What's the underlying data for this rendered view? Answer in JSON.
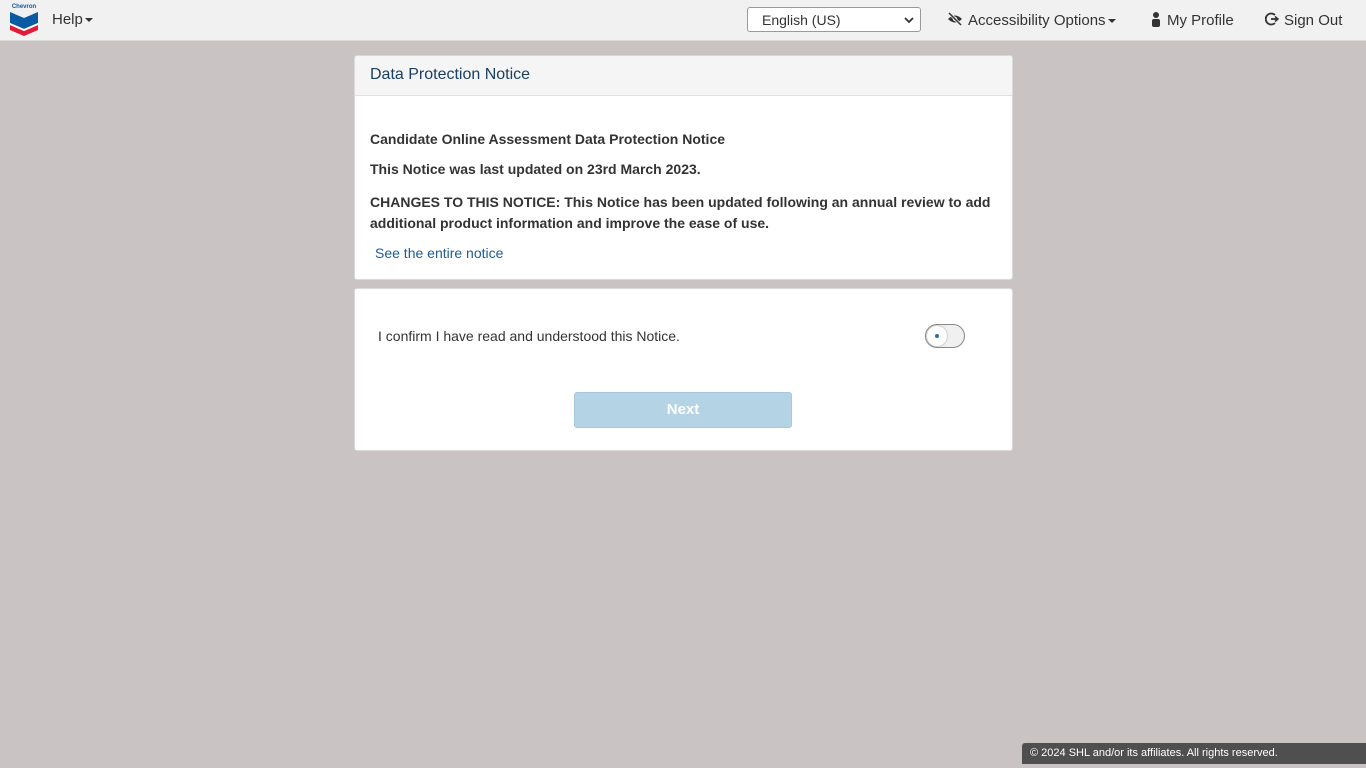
{
  "header": {
    "logo_text": "Chevron",
    "help_label": "Help",
    "language": {
      "selected": "English (US)"
    },
    "accessibility_label": "Accessibility Options",
    "profile_label": "My Profile",
    "signout_label": "Sign Out"
  },
  "notice_card": {
    "title": "Data Protection Notice",
    "heading": "Candidate Online Assessment Data Protection Notice",
    "updated": "This Notice was last updated on 23rd March 2023.",
    "changes": "CHANGES TO THIS NOTICE: This Notice has been updated following an annual review to add additional product information and improve the ease of use.",
    "link": "See the entire notice"
  },
  "confirm_card": {
    "text": "I confirm I have read and understood this Notice.",
    "toggle_checked": false,
    "next_label": "Next"
  },
  "footer": {
    "copyright": "© 2024 SHL and/or its affiliates. All rights reserved."
  },
  "colors": {
    "background": "#c9c3c3",
    "title": "#1b3f63",
    "link": "#1d5d94",
    "next_disabled": "#b4d4e6",
    "logo_blue": "#0a5aa4",
    "logo_red": "#e31937"
  }
}
